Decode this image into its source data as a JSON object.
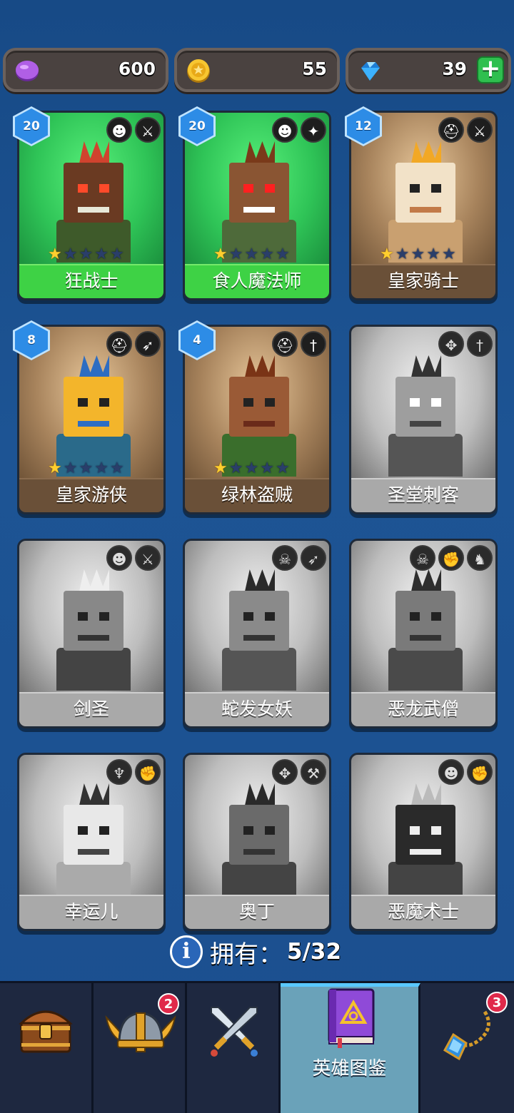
{
  "currency": {
    "purple": {
      "icon": "purple-gem-icon",
      "value": "600",
      "color": "#a34fd8"
    },
    "gold": {
      "icon": "gold-coin-icon",
      "value": "55",
      "color": "#f5c22c"
    },
    "diamond": {
      "icon": "blue-diamond-icon",
      "value": "39",
      "plus": "+",
      "color": "#3eb7ff"
    }
  },
  "heroes": [
    {
      "name": "狂战士",
      "level": "20",
      "stars": 1,
      "badge1": "orc-face-icon",
      "badge2": "sword-icon",
      "owned": true,
      "theme": "green"
    },
    {
      "name": "食人魔法师",
      "level": "20",
      "stars": 1,
      "badge1": "orc-face-icon",
      "badge2": "wand-icon",
      "owned": true,
      "theme": "green"
    },
    {
      "name": "皇家骑士",
      "level": "12",
      "stars": 1,
      "badge1": "helmet-icon",
      "badge2": "sword-icon",
      "owned": true,
      "theme": "tan"
    },
    {
      "name": "皇家游侠",
      "level": "8",
      "stars": 1,
      "badge1": "helmet-icon",
      "badge2": "bow-icon",
      "owned": true,
      "theme": "tan"
    },
    {
      "name": "绿林盗贼",
      "level": "4",
      "stars": 1,
      "badge1": "helmet-icon",
      "badge2": "dagger-icon",
      "owned": true,
      "theme": "tan"
    },
    {
      "name": "圣堂刺客",
      "badge1": "wings-icon",
      "badge2": "dagger-icon",
      "owned": false,
      "theme": "gray"
    },
    {
      "name": "剑圣",
      "badge1": "orc-face-icon",
      "badge2": "sword-icon",
      "owned": false,
      "theme": "gray"
    },
    {
      "name": "蛇发女妖",
      "badge1": "skull-icon",
      "badge2": "bow-icon",
      "owned": false,
      "theme": "gray"
    },
    {
      "name": "恶龙武僧",
      "badge1": "skull-icon",
      "badge2": "fist-icon",
      "badge3": "dragon-icon",
      "owned": false,
      "theme": "gray"
    },
    {
      "name": "幸运儿",
      "badge1": "elf-icon",
      "badge2": "fist-icon",
      "owned": false,
      "theme": "gray"
    },
    {
      "name": "奥丁",
      "badge1": "wings-icon",
      "badge2": "hammer-icon",
      "owned": false,
      "theme": "gray"
    },
    {
      "name": "恶魔术士",
      "badge1": "orc-face-icon",
      "badge2": "fist-icon",
      "owned": false,
      "theme": "gray"
    }
  ],
  "owned_summary": {
    "label": "拥有：",
    "count": "5/32"
  },
  "nav": {
    "tabs": [
      {
        "icon": "treasure-chest-icon"
      },
      {
        "icon": "viking-helmet-icon",
        "badge": "2"
      },
      {
        "icon": "crossed-swords-icon"
      },
      {
        "icon": "hero-book-icon",
        "label": "英雄图鉴",
        "active": true
      },
      {
        "icon": "amulet-icon",
        "badge": "3"
      }
    ]
  }
}
